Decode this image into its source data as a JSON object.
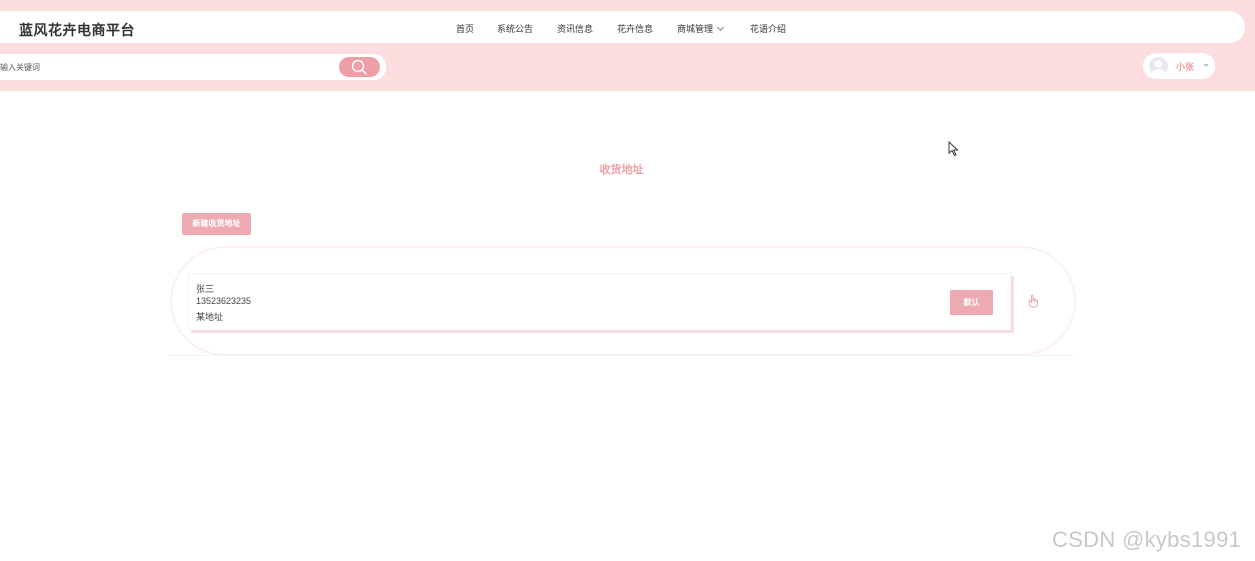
{
  "header": {
    "site_title": "蓝风花卉电商平台",
    "nav": [
      {
        "label": "首页"
      },
      {
        "label": "系统公告"
      },
      {
        "label": "资讯信息"
      },
      {
        "label": "花卉信息"
      },
      {
        "label": "商城管理"
      },
      {
        "label": "花语介绍"
      }
    ],
    "search": {
      "placeholder": "请输入关键词",
      "value": ""
    },
    "user": {
      "name": "小张"
    }
  },
  "main": {
    "title": "收货地址",
    "new_address_label": "新建收货地址",
    "addresses": [
      {
        "name": "张三",
        "phone": "13523623235",
        "address": "某地址",
        "default_label": "默认"
      }
    ]
  },
  "watermark": "CSDN @kybs1991",
  "colors": {
    "header_bg": "#fcdde0",
    "accent": "#ee9fa6",
    "button": "#eeaab1"
  }
}
